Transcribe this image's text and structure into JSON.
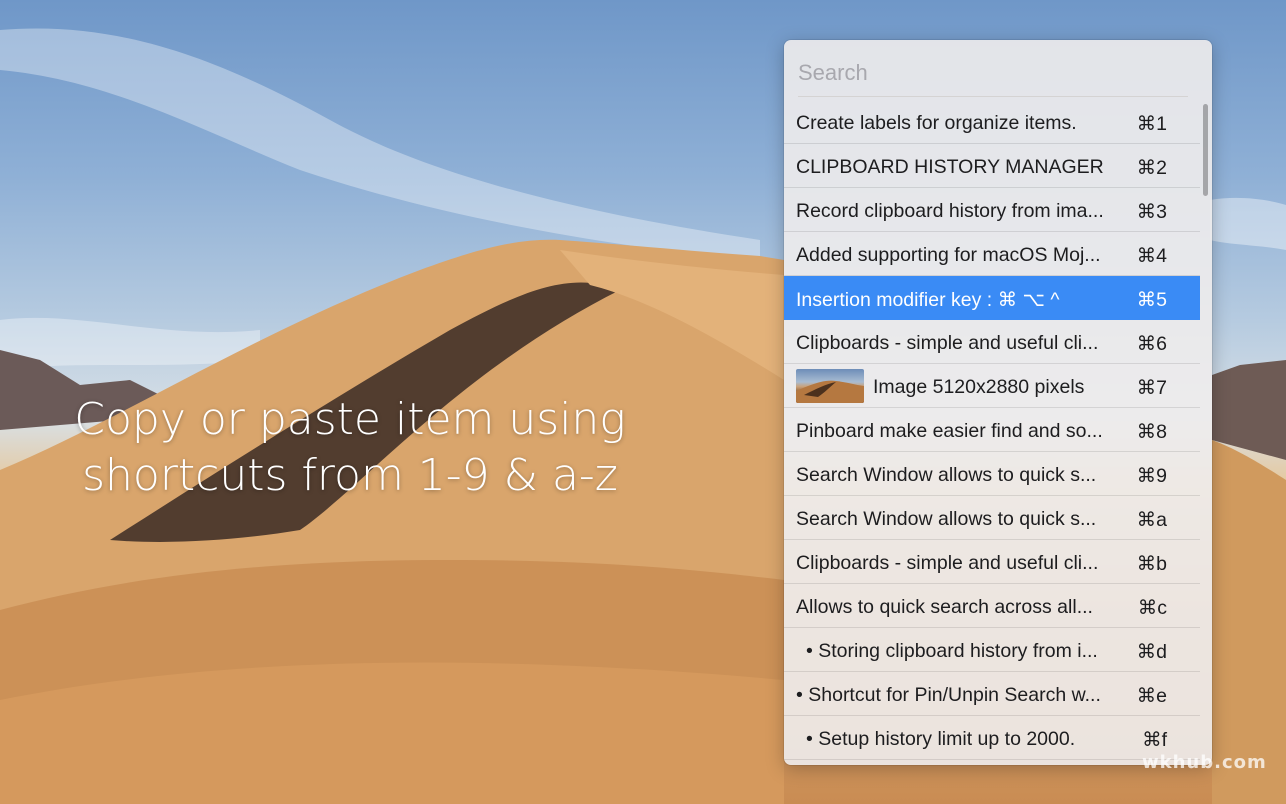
{
  "promo": {
    "line1": "Copy or paste item using",
    "line2": "shortcuts from 1-9 & a-z"
  },
  "search": {
    "placeholder": "Search",
    "value": ""
  },
  "items": [
    {
      "label": "Create labels for organize items.",
      "shortcut": "⌘1"
    },
    {
      "label": "CLIPBOARD HISTORY MANAGER",
      "shortcut": "⌘2"
    },
    {
      "label": "Record clipboard history from ima...",
      "shortcut": "⌘3"
    },
    {
      "label": "Added supporting for macOS Moj...",
      "shortcut": "⌘4"
    },
    {
      "label": "Insertion modifier key : ⌘ ⌥ ^",
      "shortcut": "⌘5"
    },
    {
      "label": "Clipboards - simple and useful cli...",
      "shortcut": "⌘6"
    },
    {
      "label": "Image 5120x2880 pixels",
      "shortcut": "⌘7"
    },
    {
      "label": "Pinboard make easier find and so...",
      "shortcut": "⌘8"
    },
    {
      "label": "Search Window allows to quick s...",
      "shortcut": "⌘9"
    },
    {
      "label": "Search Window allows to quick s...",
      "shortcut": "⌘a"
    },
    {
      "label": "Clipboards - simple and useful cli...",
      "shortcut": "⌘b"
    },
    {
      "label": "Allows to quick search across all...",
      "shortcut": "⌘c"
    },
    {
      "label": "• Storing clipboard history from i...",
      "shortcut": "⌘d"
    },
    {
      "label": "• Shortcut for Pin/Unpin Search w...",
      "shortcut": "⌘e"
    },
    {
      "label": "• Setup history limit up to 2000.",
      "shortcut": "⌘f"
    }
  ],
  "selected_item": "⌘5",
  "watermark": "wkhub.com",
  "colors": {
    "selection": "#3a8bf5",
    "panel_bg": "#eeecec",
    "placeholder": "#a8a8ae"
  },
  "icons": {
    "image_item": "image-thumbnail-icon"
  }
}
